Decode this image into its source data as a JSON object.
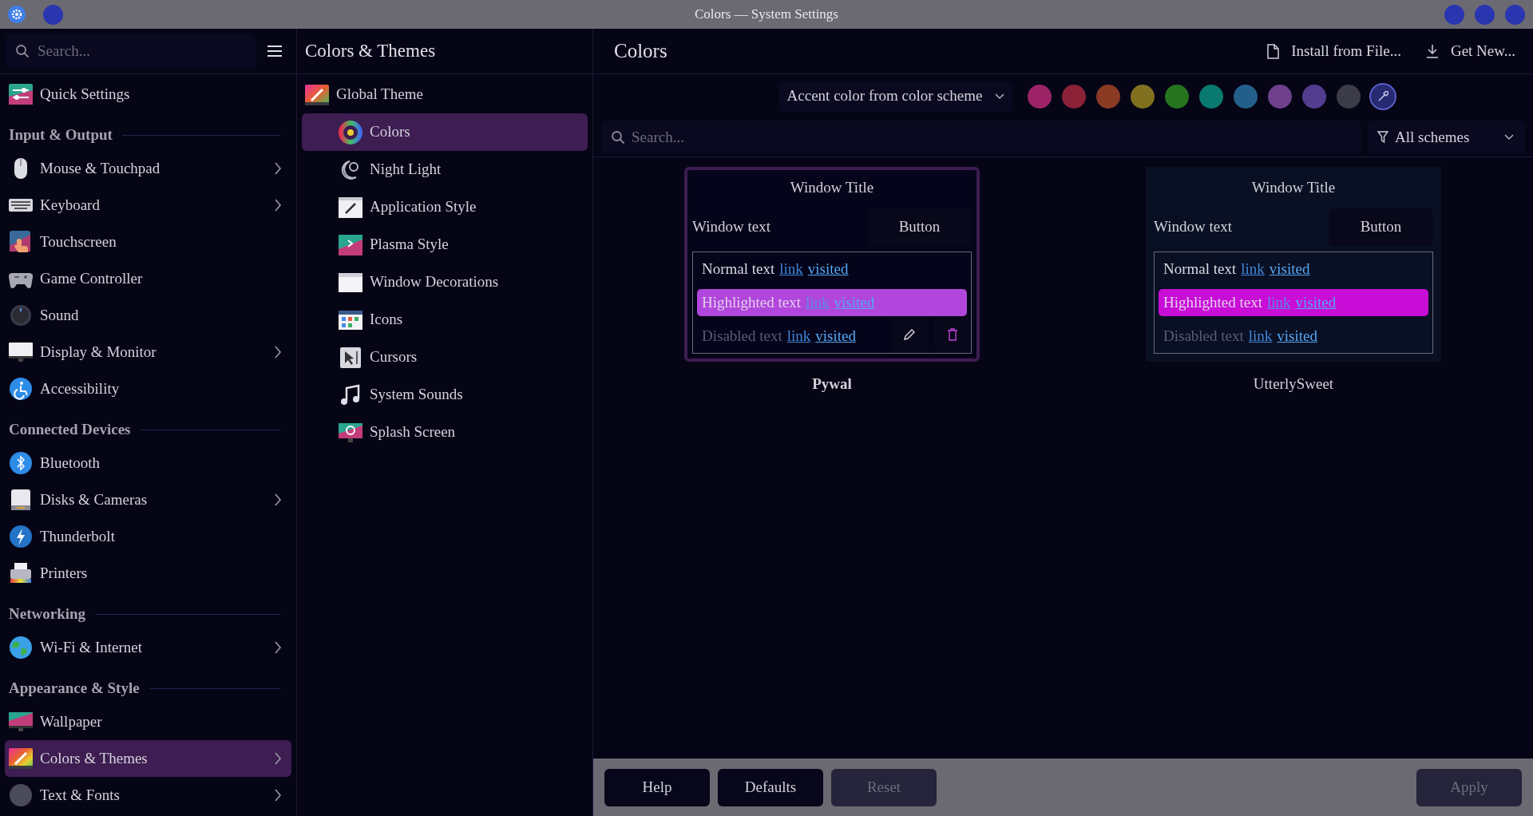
{
  "window": {
    "title": "Colors — System Settings"
  },
  "sidebar": {
    "search": {
      "placeholder": "Search..."
    },
    "items": [
      {
        "kind": "item",
        "label": "Quick Settings",
        "chevron": false,
        "selected": false
      },
      {
        "kind": "header",
        "label": "Input & Output"
      },
      {
        "kind": "item",
        "label": "Mouse & Touchpad",
        "chevron": true,
        "selected": false
      },
      {
        "kind": "item",
        "label": "Keyboard",
        "chevron": true,
        "selected": false
      },
      {
        "kind": "item",
        "label": "Touchscreen",
        "chevron": false,
        "selected": false
      },
      {
        "kind": "item",
        "label": "Game Controller",
        "chevron": false,
        "selected": false
      },
      {
        "kind": "item",
        "label": "Sound",
        "chevron": false,
        "selected": false
      },
      {
        "kind": "item",
        "label": "Display & Monitor",
        "chevron": true,
        "selected": false
      },
      {
        "kind": "item",
        "label": "Accessibility",
        "chevron": false,
        "selected": false
      },
      {
        "kind": "header",
        "label": "Connected Devices"
      },
      {
        "kind": "item",
        "label": "Bluetooth",
        "chevron": false,
        "selected": false
      },
      {
        "kind": "item",
        "label": "Disks & Cameras",
        "chevron": true,
        "selected": false
      },
      {
        "kind": "item",
        "label": "Thunderbolt",
        "chevron": false,
        "selected": false
      },
      {
        "kind": "item",
        "label": "Printers",
        "chevron": false,
        "selected": false
      },
      {
        "kind": "header",
        "label": "Networking"
      },
      {
        "kind": "item",
        "label": "Wi-Fi & Internet",
        "chevron": true,
        "selected": false
      },
      {
        "kind": "header",
        "label": "Appearance & Style"
      },
      {
        "kind": "item",
        "label": "Wallpaper",
        "chevron": false,
        "selected": false
      },
      {
        "kind": "item",
        "label": "Colors & Themes",
        "chevron": true,
        "selected": true
      },
      {
        "kind": "item",
        "label": "Text & Fonts",
        "chevron": true,
        "selected": false
      }
    ]
  },
  "middle": {
    "title": "Colors & Themes",
    "items": [
      {
        "kind": "main",
        "label": "Global Theme",
        "selected": false
      },
      {
        "kind": "sub",
        "label": "Colors",
        "selected": true
      },
      {
        "kind": "sub",
        "label": "Night Light",
        "selected": false
      },
      {
        "kind": "sub",
        "label": "Application Style",
        "selected": false
      },
      {
        "kind": "sub",
        "label": "Plasma Style",
        "selected": false
      },
      {
        "kind": "sub",
        "label": "Window Decorations",
        "selected": false
      },
      {
        "kind": "sub",
        "label": "Icons",
        "selected": false
      },
      {
        "kind": "sub",
        "label": "Cursors",
        "selected": false
      },
      {
        "kind": "sub",
        "label": "System Sounds",
        "selected": false
      },
      {
        "kind": "sub",
        "label": "Splash Screen",
        "selected": false
      }
    ]
  },
  "content": {
    "title": "Colors",
    "actions": [
      {
        "label": "Install from File..."
      },
      {
        "label": "Get New..."
      }
    ],
    "accent": {
      "value": "Accent color from color scheme"
    },
    "swatches": [
      {
        "kind": "color",
        "color": "#9c2466",
        "selected": false
      },
      {
        "kind": "color",
        "color": "#8b2238",
        "selected": false
      },
      {
        "kind": "color",
        "color": "#8b3a24",
        "selected": false
      },
      {
        "kind": "color",
        "color": "#807020",
        "selected": false
      },
      {
        "kind": "color",
        "color": "#26741e",
        "selected": false
      },
      {
        "kind": "color",
        "color": "#0a7a70",
        "selected": false
      },
      {
        "kind": "color",
        "color": "#235f8a",
        "selected": false
      },
      {
        "kind": "color",
        "color": "#6e408c",
        "selected": false
      },
      {
        "kind": "color",
        "color": "#523d8f",
        "selected": false
      },
      {
        "kind": "color",
        "color": "#3c3c48",
        "selected": false
      },
      {
        "kind": "picker",
        "color": "#262a70",
        "selected": true
      }
    ],
    "search": {
      "placeholder": "Search..."
    },
    "filter": {
      "value": "All schemes"
    },
    "schemes": [
      {
        "name": "Pywal",
        "selected": true,
        "color": "#b146dc",
        "window_title": "Window Title",
        "window_text": "Window text",
        "button": "Button",
        "rows": [
          {
            "kind": "normal",
            "text": "Normal text",
            "link": "link",
            "visited": "visited"
          },
          {
            "kind": "highlighted",
            "text": "Highlighted text",
            "link": "link",
            "visited": "visited"
          },
          {
            "kind": "disabled",
            "text": "Disabled text",
            "link": "link",
            "visited": "visited"
          }
        ]
      },
      {
        "name": "UtterlySweet",
        "selected": false,
        "color": "#c80dd6",
        "window_title": "Window Title",
        "window_text": "Window text",
        "button": "Button",
        "rows": [
          {
            "kind": "normal",
            "text": "Normal text",
            "link": "link",
            "visited": "visited"
          },
          {
            "kind": "highlighted",
            "text": "Highlighted text",
            "link": "link",
            "visited": "visited"
          },
          {
            "kind": "disabled",
            "text": "Disabled text",
            "link": "link",
            "visited": "visited"
          }
        ]
      }
    ]
  },
  "footer": {
    "buttons": [
      {
        "label": "Help",
        "disabled": false
      },
      {
        "label": "Defaults",
        "disabled": false
      },
      {
        "label": "Reset",
        "disabled": true
      },
      {
        "label": "Apply",
        "disabled": true
      }
    ]
  }
}
